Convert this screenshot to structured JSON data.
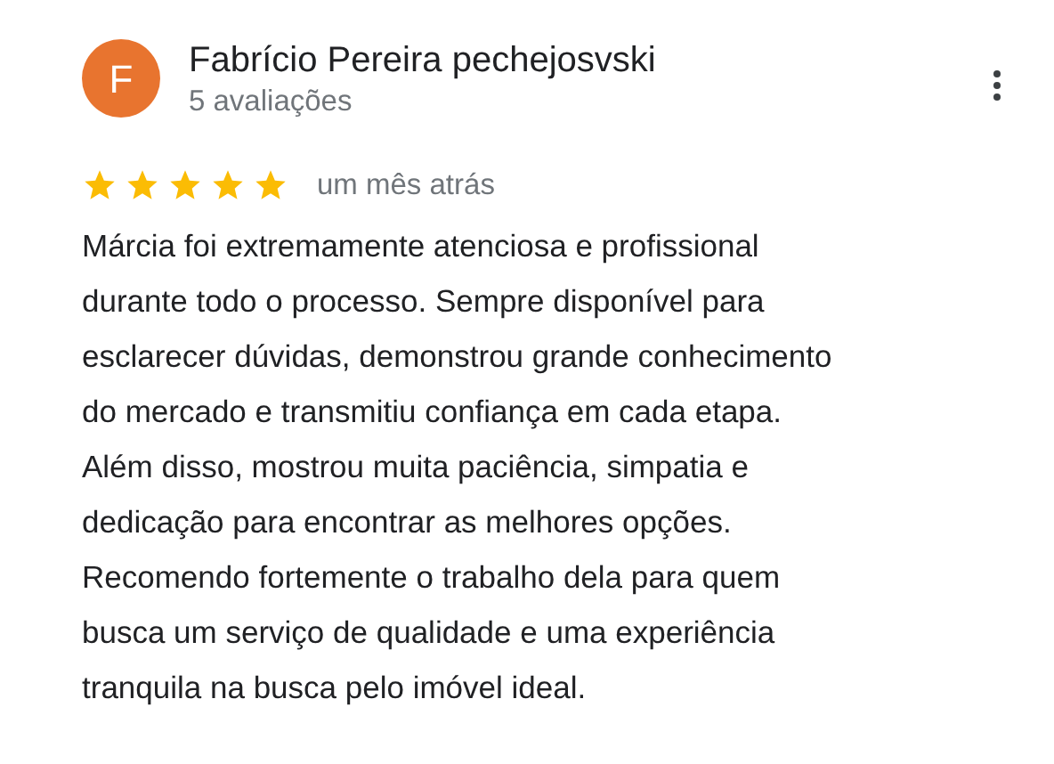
{
  "review": {
    "avatar_letter": "F",
    "author": "Fabrício Pereira pechejosvski",
    "author_meta": "5 avaliações",
    "stars": 5,
    "time": "um mês atrás",
    "text": "Márcia foi extremamente atenciosa e profissional\ndurante todo o processo. Sempre disponível para\nesclarecer dúvidas, demonstrou grande conhecimento\ndo mercado e transmitiu confiança em cada etapa.\nAlém disso, mostrou muita paciência, simpatia e\ndedicação para encontrar as melhores opções.\nRecomendo fortemente o trabalho dela para quem\nbusca um serviço de qualidade e uma experiência\ntranquila na busca pelo imóvel ideal."
  }
}
